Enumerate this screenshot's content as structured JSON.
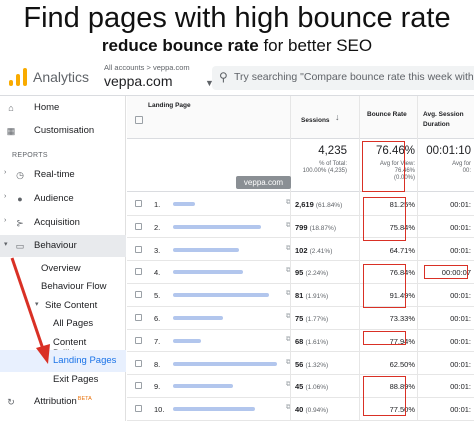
{
  "banner": {
    "title": "Find pages with high bounce rate",
    "subtitle_bold": "reduce bounce rate",
    "subtitle_rest": " for better SEO"
  },
  "topbar": {
    "app_name": "Analytics",
    "breadcrumb": "All accounts > veppa.com",
    "property": "veppa.com",
    "search_placeholder": "Try searching \"Compare bounce rate this week with la"
  },
  "sidebar": {
    "home": "Home",
    "customisation": "Customisation",
    "reports_label": "REPORTS",
    "realtime": "Real-time",
    "audience": "Audience",
    "acquisition": "Acquisition",
    "behaviour": "Behaviour",
    "overview": "Overview",
    "behaviour_flow": "Behaviour Flow",
    "site_content": "Site Content",
    "all_pages": "All Pages",
    "content_drilldown": "Content Drilldown",
    "landing_pages": "Landing Pages",
    "exit_pages": "Exit Pages",
    "attribution": "Attribution",
    "beta": "BETA"
  },
  "table": {
    "col_landing": "Landing Page",
    "col_sessions": "Sessions",
    "col_bounce": "Bounce Rate",
    "col_duration_1": "Avg. Session",
    "col_duration_2": "Duration",
    "totals": {
      "sessions": "4,235",
      "sessions_sub1": "% of Total:",
      "sessions_sub2": "100.00% (4,235)",
      "bounce": "76.46%",
      "bounce_sub1": "Avg for View:",
      "bounce_sub2": "76.46%",
      "bounce_sub3": "(0.00%)",
      "duration": "00:01:10",
      "duration_sub1": "Avg for",
      "duration_sub2": "00:"
    },
    "watermark": "veppa.com",
    "rows": [
      {
        "n": "1.",
        "sessions": "2,619",
        "pct": "(61.84%)",
        "bounce": "81.25%",
        "duration": "00:01:"
      },
      {
        "n": "2.",
        "sessions": "799",
        "pct": "(18.87%)",
        "bounce": "75.84%",
        "duration": "00:01:"
      },
      {
        "n": "3.",
        "sessions": "102",
        "pct": "(2.41%)",
        "bounce": "64.71%",
        "duration": "00:01:"
      },
      {
        "n": "4.",
        "sessions": "95",
        "pct": "(2.24%)",
        "bounce": "76.84%",
        "duration": "00:00:07"
      },
      {
        "n": "5.",
        "sessions": "81",
        "pct": "(1.91%)",
        "bounce": "91.49%",
        "duration": "00:01:"
      },
      {
        "n": "6.",
        "sessions": "75",
        "pct": "(1.77%)",
        "bounce": "73.33%",
        "duration": "00:01:"
      },
      {
        "n": "7.",
        "sessions": "68",
        "pct": "(1.61%)",
        "bounce": "77.94%",
        "duration": "00:01:"
      },
      {
        "n": "8.",
        "sessions": "56",
        "pct": "(1.32%)",
        "bounce": "62.50%",
        "duration": "00:01:"
      },
      {
        "n": "9.",
        "sessions": "45",
        "pct": "(1.06%)",
        "bounce": "88.89%",
        "duration": "00:01:"
      },
      {
        "n": "10.",
        "sessions": "40",
        "pct": "(0.94%)",
        "bounce": "77.50%",
        "duration": "00:01:"
      }
    ]
  },
  "colors": {
    "highlight": "#d93025",
    "accent": "#1a73e8",
    "logo": "#f9ab00"
  }
}
